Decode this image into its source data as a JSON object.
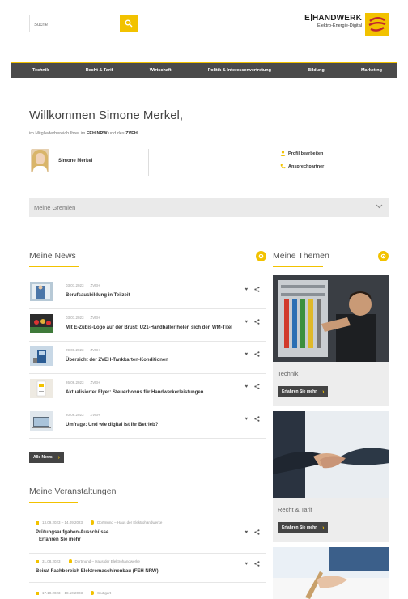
{
  "search": {
    "placeholder": "Suche"
  },
  "logo": {
    "main_left": "E",
    "main_right": "HANDWERK",
    "sub": "Elektro-Energie-Digital"
  },
  "nav": {
    "items": [
      "Technik",
      "Recht & Tarif",
      "Wirtschaft",
      "Politik & Interessenvertretung",
      "Bildung",
      "Marketing"
    ]
  },
  "welcome": {
    "title": "Willkommen Simone Merkel,",
    "sub_prefix": "im Mitgliederbereich Ihrer im",
    "org1": "FEH NRW",
    "sub_mid": "und des",
    "org2": "ZVEH",
    "sub_end": "."
  },
  "profile": {
    "name": "Simone Merkel",
    "edit_label": "Profil bearbeiten",
    "contact_label": "Ansprechpartner"
  },
  "gremien": {
    "label": "Meine Gremien"
  },
  "news": {
    "title": "Meine News",
    "items": [
      {
        "date": "03.07.2023",
        "source": "ZVEH",
        "title": "Berufsausbildung in Teilzeit"
      },
      {
        "date": "03.07.2023",
        "source": "ZVEH",
        "title": "Mit E-Zubis-Logo auf der Brust: U21-Handballer holen sich den WM-Titel"
      },
      {
        "date": "29.06.2023",
        "source": "ZVEH",
        "title": "Übersicht der ZVEH-Tankkarten-Konditionen"
      },
      {
        "date": "26.06.2023",
        "source": "ZVEH",
        "title": "Aktualisierter Flyer: Steuerbonus für Handwerkerleistungen"
      },
      {
        "date": "20.06.2023",
        "source": "ZVEH",
        "title": "Umfrage: Und wie digital ist Ihr Betrieb?"
      }
    ],
    "all_label": "Alle News"
  },
  "events": {
    "title": "Meine Veranstaltungen",
    "items": [
      {
        "date": "13.09.2023 – 14.09.2023",
        "place": "Dortmund – Haus der Elektrohandwerke",
        "title": "Prüfungsaufgaben-Ausschüsse",
        "more": "Erfahren Sie mehr"
      },
      {
        "date": "31.08.2023",
        "place": "Dortmund – Haus der Elektrohandwerke",
        "title": "Beirat Fachbereich Elektromaschinenbau (FEH NRW)"
      },
      {
        "date": "17.10.2023 – 18.10.2023",
        "place": "Stuttgart"
      }
    ]
  },
  "themen": {
    "title": "Meine Themen",
    "items": [
      {
        "label": "Technik",
        "button": "Erfahren Sie mehr"
      },
      {
        "label": "Recht & Tarif",
        "button": "Erfahren Sie mehr"
      }
    ]
  },
  "colors": {
    "accent": "#f2c200",
    "nav_bg": "#4a4a4a",
    "button_bg": "#444444"
  }
}
